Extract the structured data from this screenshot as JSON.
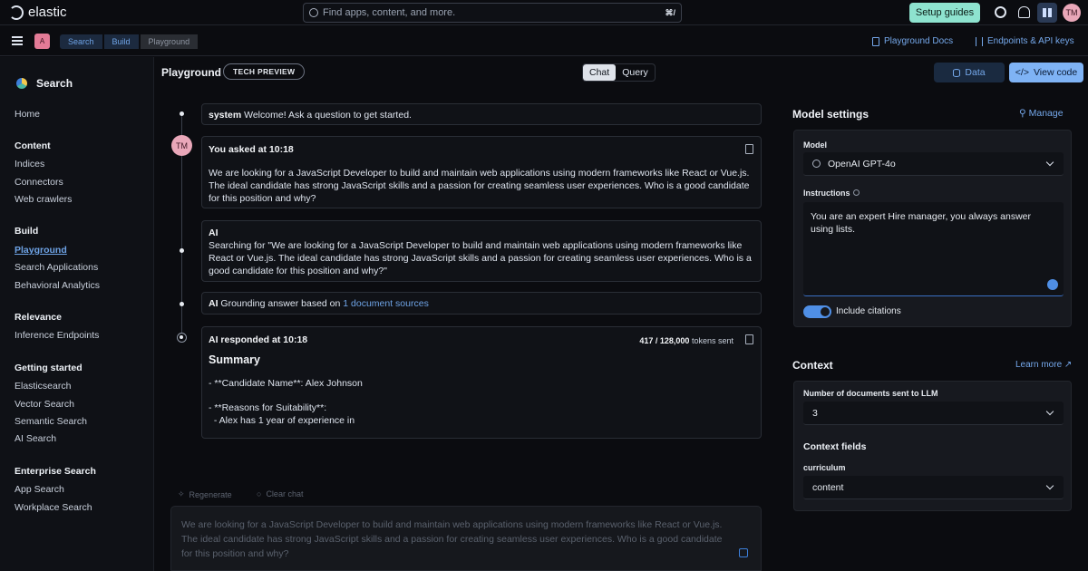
{
  "topbar": {
    "brand": "elastic",
    "search_placeholder": "Find apps, content, and more.",
    "search_shortcut": "⌘/",
    "setup_label": "Setup guides",
    "user_initials": "TM"
  },
  "secondbar": {
    "space_initial": "A",
    "breadcrumbs": [
      "Search",
      "Build",
      "Playground"
    ],
    "docs_link": "Playground Docs",
    "endpoints_link": "Endpoints & API keys"
  },
  "sidebar": {
    "title": "Search",
    "home": "Home",
    "content_header": "Content",
    "content": [
      "Indices",
      "Connectors",
      "Web crawlers"
    ],
    "build_header": "Build",
    "build": [
      "Playground",
      "Search Applications",
      "Behavioral Analytics"
    ],
    "relevance_header": "Relevance",
    "relevance": [
      "Inference Endpoints"
    ],
    "getting_started_header": "Getting started",
    "getting_started": [
      "Elasticsearch",
      "Vector Search",
      "Semantic Search",
      "AI Search"
    ],
    "enterprise_header": "Enterprise Search",
    "enterprise": [
      "App Search",
      "Workplace Search"
    ]
  },
  "header": {
    "title": "Playground",
    "badge": "TECH PREVIEW",
    "tab_chat": "Chat",
    "tab_query": "Query",
    "data_button": "Data",
    "view_code_button": "View code"
  },
  "chat": {
    "system_role": "system",
    "system_text": "Welcome! Ask a question to get started.",
    "user_initials": "TM",
    "user_meta": "You asked at 10:18",
    "user_text": "We are looking for a JavaScript Developer to build and maintain web applications using modern frameworks like React or Vue.js. The ideal candidate has strong JavaScript skills and a passion for creating seamless user experiences. Who is a good candidate for this position and why?",
    "ai_label": "AI",
    "ai_search_text": "Searching for \"We are looking for a JavaScript Developer to build and maintain web applications using modern frameworks like React or Vue.js. The ideal candidate has strong JavaScript skills and a passion for creating seamless user experiences. Who is a good candidate for this position and why?\"",
    "grounding_label": "AI",
    "grounding_text": "Grounding answer based on",
    "grounding_link": "1 document sources",
    "response_meta": "AI responded at 10:18",
    "tokens_count": "417 / 128,000",
    "tokens_label": "tokens sent",
    "summary_heading": "Summary",
    "line1": "- **Candidate Name**: Alex Johnson",
    "line2": "- **Reasons for Suitability**:",
    "line3": "  - Alex has 1 year of experience in",
    "regenerate": "Regenerate",
    "clear_chat": "Clear chat",
    "input_text": "We are looking for a JavaScript Developer to build and maintain web applications using modern frameworks like React or Vue.js. The ideal candidate has strong JavaScript skills and a passion for creating seamless user experiences. Who is a good candidate for this position and why?"
  },
  "model_settings": {
    "title": "Model settings",
    "manage": "Manage",
    "model_label": "Model",
    "model_value": "OpenAI GPT-4o",
    "instructions_label": "Instructions",
    "instructions_value": "You are an expert Hire manager, you always answer using lists.",
    "citations_label": "Include citations",
    "citations_on": true
  },
  "context": {
    "title": "Context",
    "learn_more": "Learn more",
    "docs_label": "Number of documents sent to LLM",
    "docs_value": "3",
    "fields_label": "Context fields",
    "field_name": "curriculum",
    "field_value": "content"
  },
  "colors": {
    "accent": "#7fb3f5",
    "setup": "#8ee3cf",
    "avatar": "#e9a7b9"
  }
}
